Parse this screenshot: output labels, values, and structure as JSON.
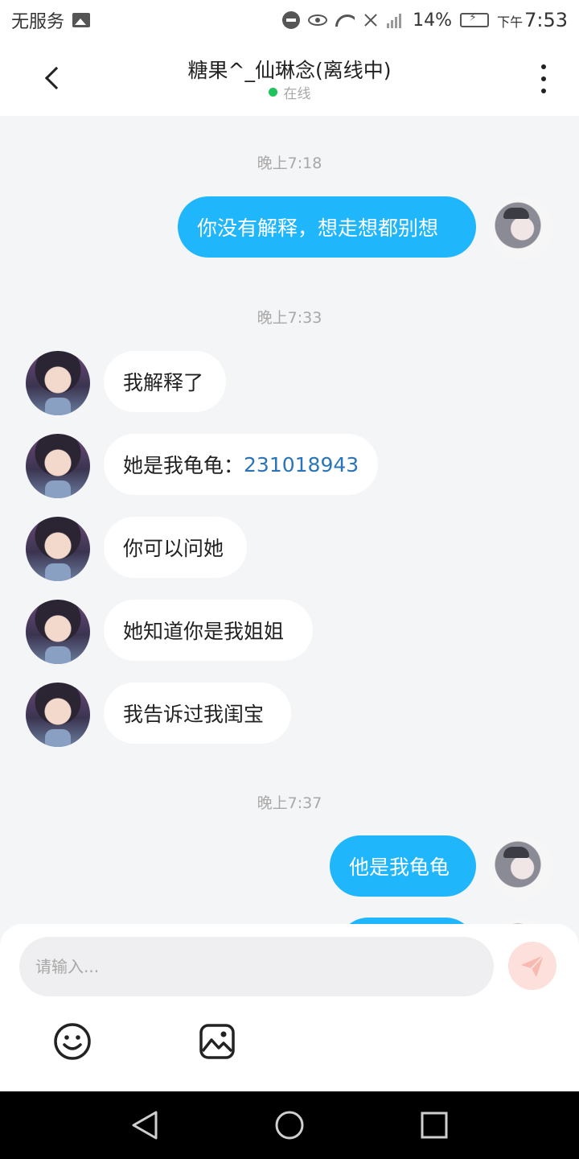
{
  "status_bar": {
    "carrier": "无服务",
    "battery": "14%",
    "time_prefix": "下午",
    "time": "7:53"
  },
  "header": {
    "title": "糖果^_仙琳念(离线中)",
    "status": "在线",
    "status_color": "#1ec45b"
  },
  "messages": [
    {
      "type": "timestamp",
      "text": "晚上7:18"
    },
    {
      "type": "outgoing",
      "text": "你没有解释，想走想都别想"
    },
    {
      "type": "timestamp",
      "text": "晚上7:33"
    },
    {
      "type": "incoming",
      "text": "我解释了"
    },
    {
      "type": "incoming",
      "text": "她是我龟龟：",
      "link": "231018943"
    },
    {
      "type": "incoming",
      "text": "你可以问她"
    },
    {
      "type": "incoming",
      "text": "她知道你是我姐姐"
    },
    {
      "type": "incoming",
      "text": "我告诉过我闺宝"
    },
    {
      "type": "timestamp",
      "text": "晚上7:37"
    },
    {
      "type": "outgoing",
      "text": "他是我龟龟"
    }
  ],
  "composer": {
    "placeholder": "请输入...",
    "value": ""
  },
  "colors": {
    "outgoing_bubble": "#1fb6fb",
    "incoming_bubble": "#ffffff",
    "send_button": "#fde0dc",
    "link": "#2a74b8"
  },
  "icons": [
    "gallery-icon",
    "dnd-icon",
    "eye-icon",
    "wifi-icon",
    "no-call-icon",
    "signal-icon",
    "battery-icon",
    "back-chevron-icon",
    "more-vertical-icon",
    "send-icon",
    "emoji-icon",
    "image-icon",
    "nav-back-icon",
    "nav-home-icon",
    "nav-recents-icon"
  ]
}
